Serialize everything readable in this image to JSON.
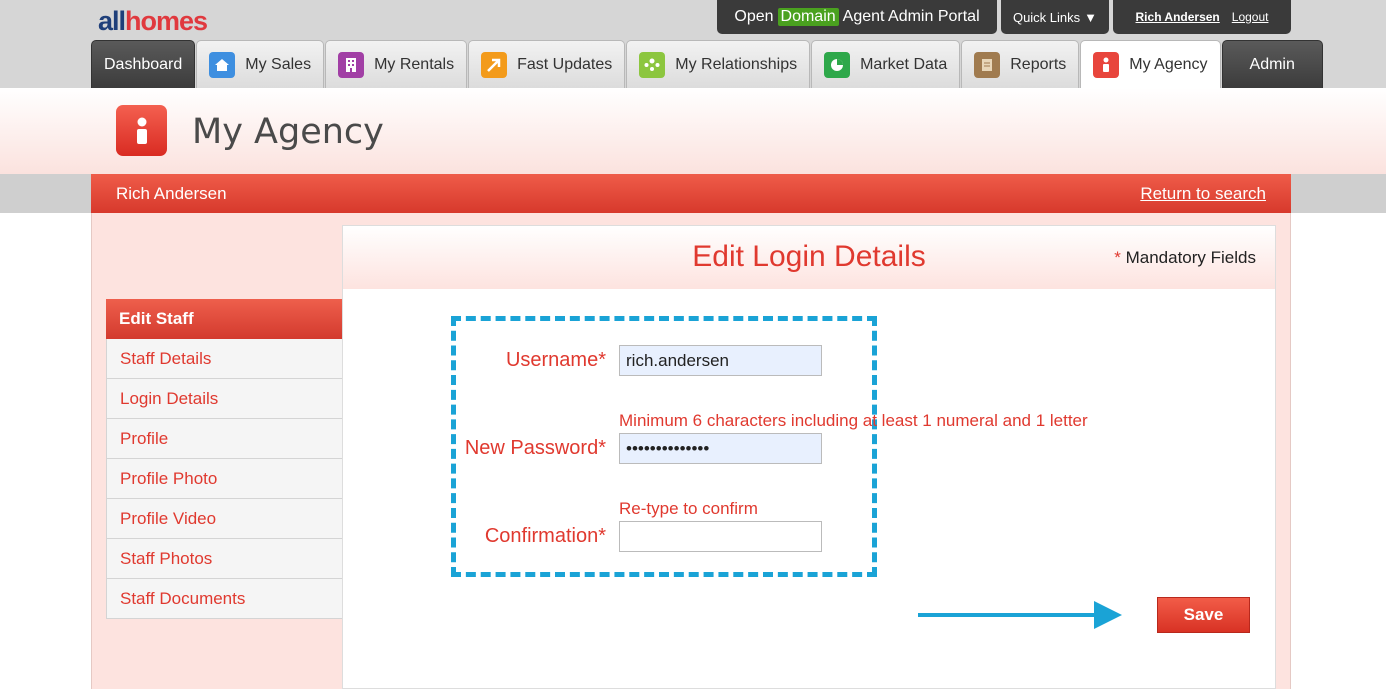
{
  "brand": {
    "logo_part1": "all",
    "logo_part2": "homes"
  },
  "topbar": {
    "portal_prefix": "Open",
    "portal_domain": "Domain",
    "portal_suffix": "Agent Admin Portal",
    "quick_links": "Quick Links",
    "quick_links_arrow": "▼",
    "user_name": "Rich Andersen",
    "logout": "Logout"
  },
  "tabs": [
    {
      "label": "Dashboard",
      "icon": "",
      "icon_color": ""
    },
    {
      "label": "My Sales",
      "icon": "house-icon",
      "icon_color": "#3e8fe0"
    },
    {
      "label": "My Rentals",
      "icon": "building-icon",
      "icon_color": "#a13fa5"
    },
    {
      "label": "Fast Updates",
      "icon": "arrow-up-icon",
      "icon_color": "#f39b1b"
    },
    {
      "label": "My Relationships",
      "icon": "people-icon",
      "icon_color": "#8cc63f"
    },
    {
      "label": "Market Data",
      "icon": "pie-chart-icon",
      "icon_color": "#2ea84a"
    },
    {
      "label": "Reports",
      "icon": "document-icon",
      "icon_color": "#a07b4f"
    },
    {
      "label": "My Agency",
      "icon": "person-icon",
      "icon_color": "#e8453c"
    },
    {
      "label": "Admin",
      "icon": "",
      "icon_color": ""
    }
  ],
  "header": {
    "title": "My Agency",
    "icon": "person-icon"
  },
  "namebar": {
    "name": "Rich Andersen",
    "return_link": "Return to search"
  },
  "sidenav": {
    "heading": "Edit Staff",
    "items": [
      "Staff Details",
      "Login Details",
      "Profile",
      "Profile Photo",
      "Profile Video",
      "Staff Photos",
      "Staff Documents"
    ]
  },
  "form": {
    "title": "Edit Login Details",
    "mandatory_star": "*",
    "mandatory_text": "Mandatory Fields",
    "username_label": "Username*",
    "username_value": "rich.andersen",
    "password_hint": "Minimum 6 characters including at least 1 numeral and 1 letter",
    "password_label": "New Password*",
    "password_value": "••••••••••••••",
    "confirm_hint": "Re-type to confirm",
    "confirm_label": "Confirmation*",
    "confirm_value": "",
    "save": "Save"
  },
  "colors": {
    "accent_red": "#e0392f",
    "annotation_blue": "#1aa3d6"
  }
}
